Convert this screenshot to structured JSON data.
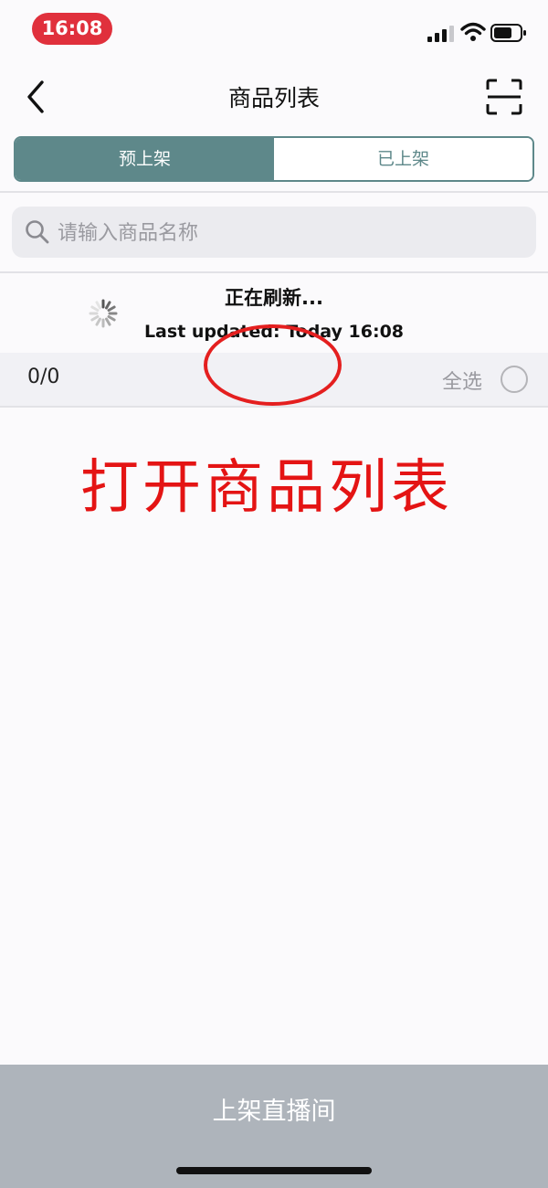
{
  "status_bar": {
    "time": "16:08",
    "icons": [
      "signal-icon",
      "wifi-icon",
      "battery-icon"
    ]
  },
  "nav": {
    "title": "商品列表",
    "back_icon": "chevron-left-icon",
    "scan_icon": "scan-icon"
  },
  "tabs": [
    {
      "label": "预上架",
      "active": true
    },
    {
      "label": "已上架",
      "active": false
    }
  ],
  "search": {
    "placeholder": "请输入商品名称",
    "value": ""
  },
  "refresh": {
    "title": "正在刷新...",
    "updated": "Last updated: Today 16:08"
  },
  "list_header": {
    "count": "0/0",
    "select_all_label": "全选",
    "select_all_checked": false
  },
  "annotation": {
    "caption": "打开商品列表"
  },
  "footer": {
    "button_label": "上架直播间"
  },
  "colors": {
    "accent": "#5e888a",
    "time_pill": "#e0303c",
    "annotation": "#e41f1f",
    "footer_bg": "#aeb4bb"
  }
}
